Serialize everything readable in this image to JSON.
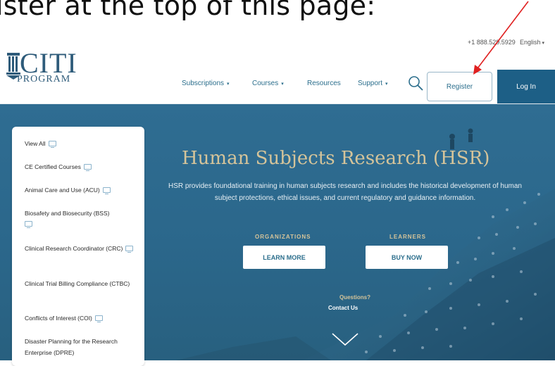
{
  "caption": "ister at the top of this page:",
  "topbar": {
    "phone": "+1 888.529.5929",
    "language": "English"
  },
  "logo": {
    "brand": "CITI",
    "sub": "PROGRAM"
  },
  "nav": {
    "items": [
      {
        "label": "Subscriptions",
        "has_caret": true
      },
      {
        "label": "Courses",
        "has_caret": true
      },
      {
        "label": "Resources",
        "has_caret": false
      },
      {
        "label": "Support",
        "has_caret": true
      }
    ],
    "register": "Register",
    "login": "Log In"
  },
  "hero": {
    "title": "Human Subjects Research (HSR)",
    "description": "HSR provides foundational training in human subjects research and includes the historical development of human subject protections, ethical issues, and current regulatory and guidance information.",
    "org_label": "ORGANIZATIONS",
    "learners_label": "LEARNERS",
    "learn_more": "LEARN MORE",
    "buy_now": "BUY NOW",
    "questions": "Questions?",
    "contact": "Contact Us"
  },
  "sidebar": {
    "items": [
      {
        "label": "View All",
        "icon": "screen-icon"
      },
      {
        "label": "CE Certified Courses",
        "icon": "screen-icon"
      },
      {
        "label": "Animal Care and Use (ACU)",
        "icon": "screen-icon"
      },
      {
        "label": "Biosafety and Biosecurity (BSS)",
        "icon": "screen-icon"
      },
      {
        "label": "Clinical Research Coordinator (CRC)",
        "icon": "screen-icon"
      },
      {
        "label": "Clinical Trial Billing Compliance (CTBC)",
        "icon": ""
      },
      {
        "label": "Conflicts of Interest (COI)",
        "icon": "screen-icon"
      },
      {
        "label": "Disaster Planning for the Research Enterprise (DPRE)",
        "icon": ""
      }
    ]
  },
  "colors": {
    "hero": "#2f6d92",
    "gold": "#d5c49a",
    "nav": "#2b6e8c",
    "login": "#1d5f86",
    "arrow": "#e02020"
  }
}
